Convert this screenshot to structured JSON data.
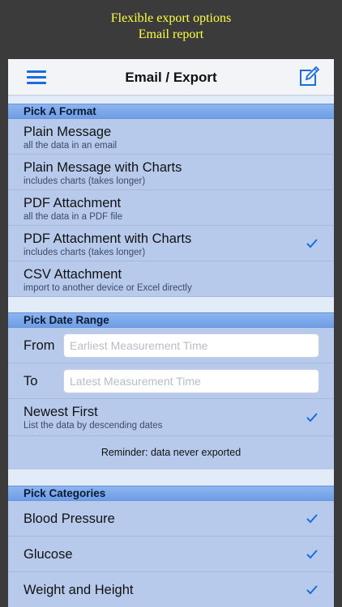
{
  "banner": {
    "line1": "Flexible export options",
    "line2": "Email report"
  },
  "navbar": {
    "title": "Email / Export",
    "left_icon": "menu-icon",
    "right_icon": "compose-icon",
    "accent_color": "#1a6ce0"
  },
  "format_section": {
    "header": "Pick A Format",
    "options": [
      {
        "title": "Plain Message",
        "subtitle": "all the data in an email",
        "selected": false
      },
      {
        "title": "Plain Message with Charts",
        "subtitle": "includes charts (takes longer)",
        "selected": false
      },
      {
        "title": "PDF Attachment",
        "subtitle": "all the data in a PDF file",
        "selected": false
      },
      {
        "title": "PDF Attachment with Charts",
        "subtitle": "includes charts (takes longer)",
        "selected": true
      },
      {
        "title": "CSV Attachment",
        "subtitle": "import to another device or Excel directly",
        "selected": false
      }
    ]
  },
  "date_section": {
    "header": "Pick Date Range",
    "from_label": "From",
    "from_placeholder": "Earliest Measurement Time",
    "to_label": "To",
    "to_placeholder": "Latest Measurement Time",
    "newest_first": {
      "title": "Newest First",
      "subtitle": "List the data by descending dates",
      "selected": true
    },
    "reminder": "Reminder: data never exported"
  },
  "categories_section": {
    "header": "Pick Categories",
    "items": [
      {
        "title": "Blood Pressure",
        "selected": true
      },
      {
        "title": "Glucose",
        "selected": true
      },
      {
        "title": "Weight and Height",
        "selected": true
      }
    ]
  }
}
